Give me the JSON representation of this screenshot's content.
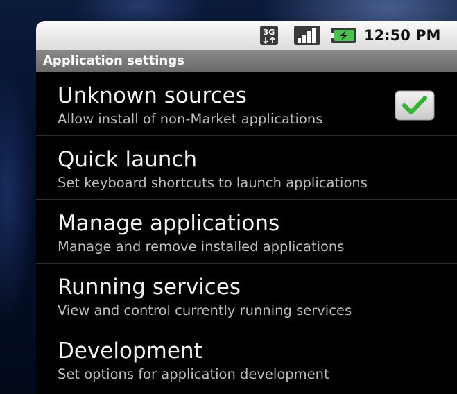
{
  "status_bar": {
    "time": "12:50 PM",
    "network_label": "3G",
    "icons": [
      "3g-icon",
      "signal-icon",
      "battery-charging-icon"
    ]
  },
  "title_bar": {
    "title": "Application settings"
  },
  "settings": [
    {
      "title": "Unknown sources",
      "summary": "Allow install of non-Market applications",
      "checkbox": true,
      "checked": true
    },
    {
      "title": "Quick launch",
      "summary": "Set keyboard shortcuts to launch applications"
    },
    {
      "title": "Manage applications",
      "summary": "Manage and remove installed applications"
    },
    {
      "title": "Running services",
      "summary": "View and control currently running services"
    },
    {
      "title": "Development",
      "summary": "Set options for application development"
    }
  ],
  "colors": {
    "check_green": "#3cc43c",
    "background": "#000000",
    "title_text": "#f2f2f2",
    "summary_text": "#bdbdbd"
  }
}
